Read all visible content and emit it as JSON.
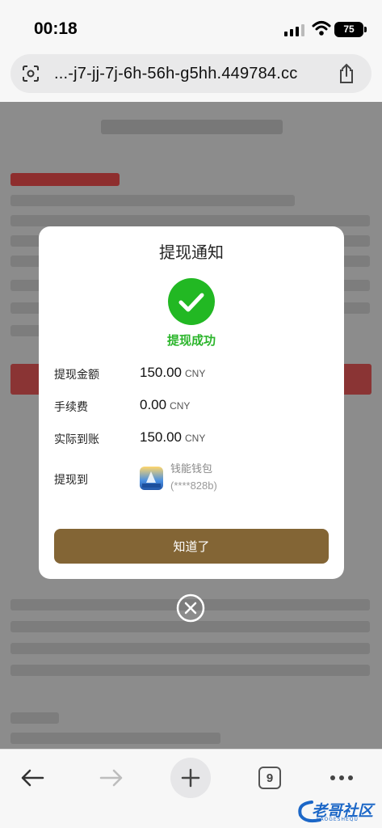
{
  "status_bar": {
    "time": "00:18",
    "battery": "75"
  },
  "address_bar": {
    "url": "...-j7-jj-7j-6h-56h-g5hh.449784.cc"
  },
  "modal": {
    "title": "提现通知",
    "success_text": "提现成功",
    "rows": [
      {
        "label": "提现金额",
        "value": "150.00",
        "unit": "CNY"
      },
      {
        "label": "手续费",
        "value": "0.00",
        "unit": "CNY"
      },
      {
        "label": "实际到账",
        "value": "150.00",
        "unit": "CNY"
      }
    ],
    "destination": {
      "label": "提现到",
      "wallet_name": "钱能钱包",
      "account": "(****828b)"
    },
    "confirm_label": "知道了"
  },
  "toolbar": {
    "tab_count": "9"
  },
  "watermark": {
    "text": "老哥社区",
    "sub": "LAOGESHEQU"
  },
  "colors": {
    "success_green": "#2bb52b",
    "button_brown": "#836535",
    "check_green": "#22b823"
  },
  "icons": [
    "scan-icon",
    "share-icon",
    "check-circle-icon",
    "close-circle-icon",
    "back-arrow-icon",
    "forward-arrow-icon",
    "plus-icon",
    "tabs-icon",
    "more-icon",
    "wallet-app-icon"
  ]
}
